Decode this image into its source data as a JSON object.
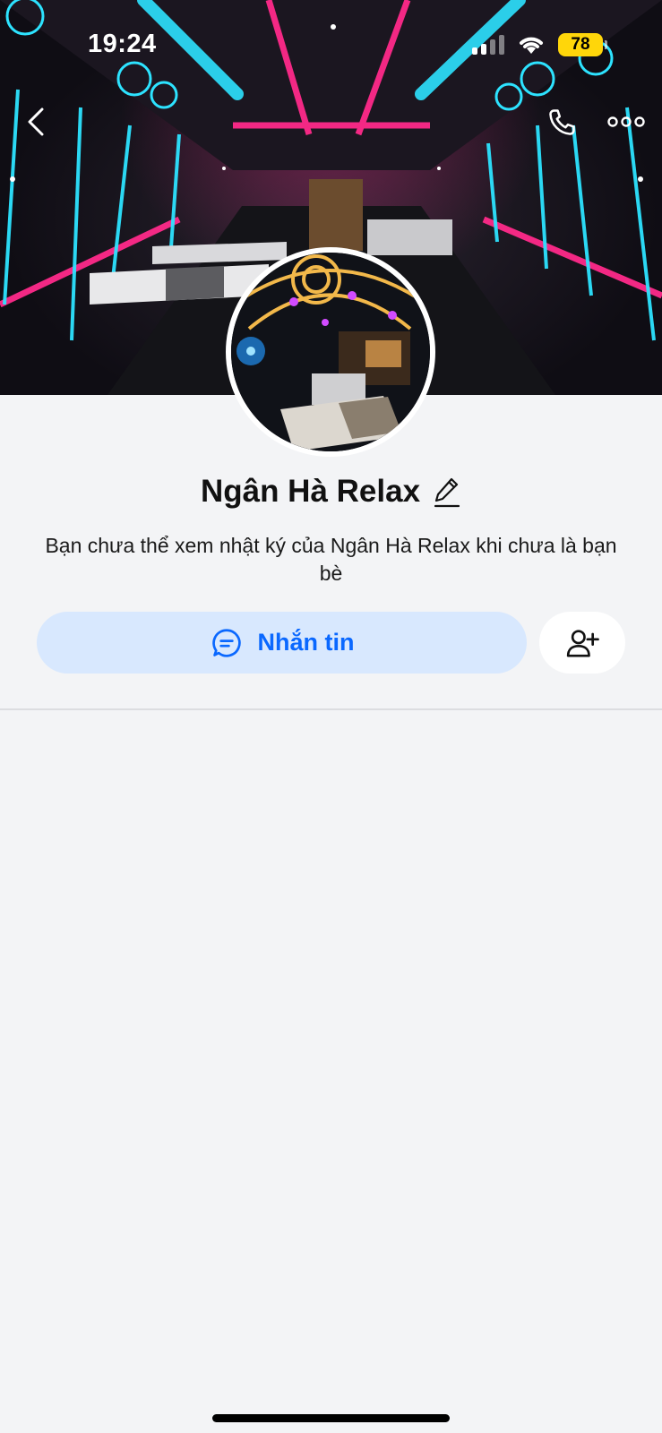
{
  "status_bar": {
    "time": "19:24",
    "battery_level": "78",
    "signal_bars_active": 2,
    "signal_bars_total": 4,
    "icons": [
      "signal-icon",
      "wifi-icon",
      "battery-icon"
    ]
  },
  "top_nav": {
    "icons": [
      "back-icon",
      "phone-icon",
      "more-icon"
    ]
  },
  "profile": {
    "name": "Ngân Hà Relax",
    "edit_icon": "pencil-icon",
    "notice": "Bạn chưa thể xem nhật ký của Ngân Hà Relax khi chưa là bạn bè"
  },
  "actions": {
    "message_label": "Nhắn tin",
    "message_icon": "chat-bubble-icon",
    "add_friend_icon": "add-user-icon"
  },
  "colors": {
    "accent": "#0a68ff",
    "message_button_bg": "#d8e8fe",
    "page_bg": "#f3f4f6",
    "battery": "#ffd60a"
  }
}
